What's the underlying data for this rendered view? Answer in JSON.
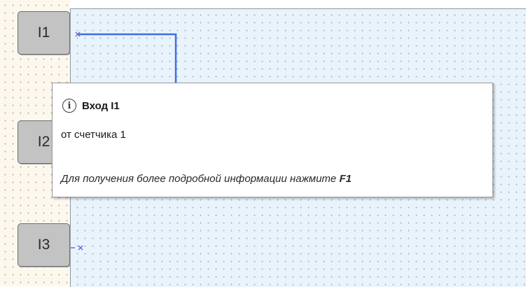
{
  "inputs": [
    {
      "label": "I1"
    },
    {
      "label": "I2"
    },
    {
      "label": "I3"
    }
  ],
  "tooltip": {
    "title": "Вход I1",
    "body": "от счетчика 1",
    "hint_text": "Для получения более подробной информации нажмите",
    "hint_key": "F1"
  },
  "colors": {
    "wire": "#3f6fe0",
    "pin": "#6a6adf",
    "canvas_bg": "#e9f3fb",
    "left_bg": "#fdf8ee"
  }
}
